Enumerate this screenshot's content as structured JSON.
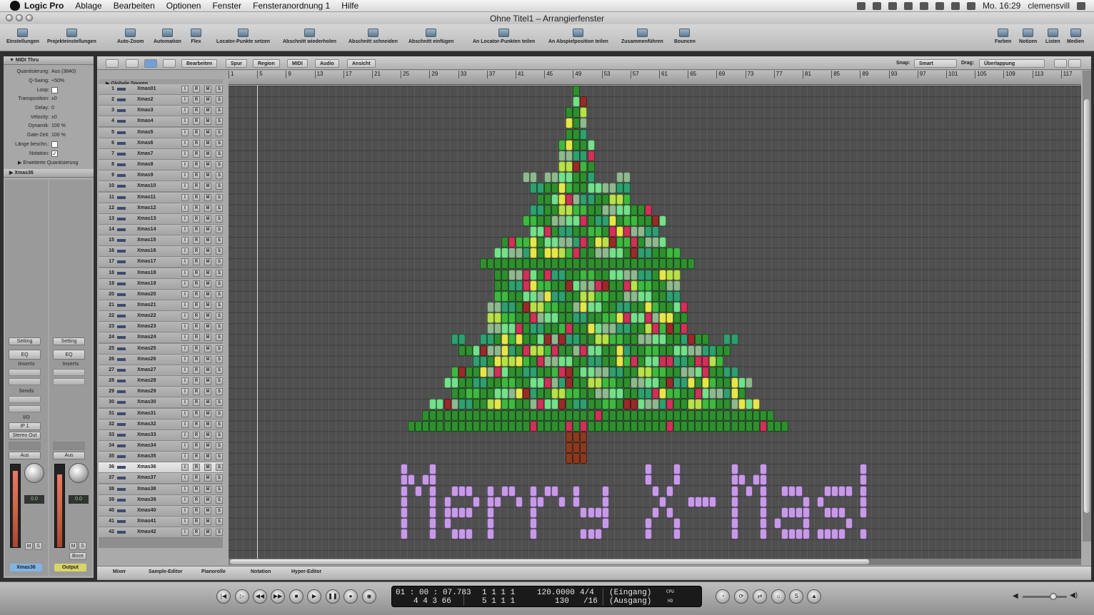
{
  "menubar": {
    "app": "Logic Pro",
    "items": [
      "Ablage",
      "Bearbeiten",
      "Optionen",
      "Fenster",
      "Fensteranordnung 1",
      "Hilfe"
    ],
    "clock": "Mo. 16:29",
    "user": "clemensvill"
  },
  "window": {
    "title": "Ohne Titel1 – Arrangierfenster"
  },
  "toolbar": {
    "items": [
      "Einstellungen",
      "Projekteinstellungen",
      "Auto-Zoom",
      "Automation",
      "Flex",
      "Locator-Punkte setzen",
      "Abschnitt wiederholen",
      "Abschnitt schneiden",
      "Abschnitt einfügen",
      "An Locator-Punkten teilen",
      "An Abspielposition teilen",
      "Zusammenführen",
      "Bouncen",
      "Farben",
      "Notizen",
      "Listen",
      "Medien"
    ]
  },
  "inspector": {
    "region_header": "MIDI Thru",
    "params": [
      {
        "label": "Quantisierung:",
        "value": "Aus (3840)"
      },
      {
        "label": "Q-Swing:",
        "value": "+50%"
      },
      {
        "label": "Loop:",
        "value": ""
      },
      {
        "label": "Transposition:",
        "value": "±0"
      },
      {
        "label": "Delay:",
        "value": "0"
      },
      {
        "label": "Velocity:",
        "value": "±0"
      },
      {
        "label": "Dynamik:",
        "value": "100 %"
      },
      {
        "label": "Gate-Zeit:",
        "value": "100 %"
      },
      {
        "label": "Länge beschn.:",
        "value": ""
      },
      {
        "label": "Notation:",
        "value": ""
      }
    ],
    "extended": "Erweiterte Quantisierung",
    "track_header": "Xmas36",
    "strip1": {
      "setting": "Setting",
      "eq": "EQ",
      "inserts": "Inserts",
      "sends": "Sends",
      "io": "I/O",
      "input": "IP 1",
      "output": "Stereo Out",
      "auto": "Aus",
      "pan": "0.0",
      "m": "M",
      "s": "S",
      "name": "Xmas36"
    },
    "strip2": {
      "setting": "Setting",
      "eq": "EQ",
      "inserts": "Inserts",
      "auto": "Aus",
      "pan": "0.0",
      "m": "M",
      "s": "S",
      "bnce": "Bnce",
      "name": "Output"
    }
  },
  "localmenu": {
    "menus": [
      "Bearbeiten",
      "Spur",
      "Region",
      "MIDI",
      "Audio",
      "Ansicht"
    ],
    "snap_label": "Snap:",
    "snap_value": "Smart",
    "drag_label": "Drag:",
    "drag_value": "Überlappung"
  },
  "global_tracks": "Globale Spuren",
  "ruler": {
    "marks": [
      "1",
      "5",
      "9",
      "13",
      "17",
      "21",
      "25",
      "29",
      "33",
      "37",
      "41",
      "45",
      "49",
      "53",
      "57",
      "61",
      "65",
      "69",
      "73",
      "77",
      "81",
      "85",
      "89",
      "93",
      "97",
      "101",
      "105",
      "109",
      "113",
      "117"
    ]
  },
  "tracks": [
    "Xmas01",
    "Xmas2",
    "Xmas3",
    "Xmas4",
    "Xmas5",
    "Xmas6",
    "Xmas7",
    "Xmas8",
    "Xmas9",
    "Xmas10",
    "Xmas11",
    "Xmas12",
    "Xmas13",
    "Xmas14",
    "Xmas15",
    "Xmas16",
    "Xmas17",
    "Xmas18",
    "Xmas19",
    "Xmas20",
    "Xmas21",
    "Xmas22",
    "Xmas23",
    "Xmas24",
    "Xmas25",
    "Xmas26",
    "Xmas27",
    "Xmas28",
    "Xmas29",
    "Xmas30",
    "Xmas31",
    "Xmas32",
    "Xmas33",
    "Xmas34",
    "Xmas35",
    "Xmas36",
    "Xmas37",
    "Xmas38",
    "Xmas39",
    "Xmas40",
    "Xmas41",
    "Xmas42"
  ],
  "track_buttons": [
    "I",
    "R",
    "M",
    "S"
  ],
  "selected_track": "Xmas36",
  "bottom_tabs": [
    "Mixer",
    "Sample-Editor",
    "Pianorolle",
    "Notation",
    "Hyper-Editor"
  ],
  "transport": {
    "smpte": "01 : 00 : 07.783",
    "smpte2": "4   4   3   66",
    "bars": "1   1   1     1",
    "bars2": "5   1   1     1",
    "tempo": "120.0000",
    "tempo2": "130",
    "sig": "4/4",
    "div": "/16",
    "in": "(Eingang)",
    "out": "(Ausgang)",
    "cpu": "CPU",
    "hd": "HD"
  },
  "colors": {
    "dark_green": "#2f8f2f",
    "green": "#3fb83f",
    "light_green": "#73e08a",
    "sage": "#8fb88f",
    "teal": "#2f9f6f",
    "lime": "#b8e04a",
    "yellow": "#e6e64a",
    "red": "#d0305a",
    "dark_red": "#9a2a2a",
    "trunk": "#8a3a1e",
    "lavender": "#c79ae8"
  },
  "chart_data": {
    "type": "table",
    "tree_rows": [
      {
        "track": 1,
        "runs": [
          [
            49,
            1
          ]
        ]
      },
      {
        "track": 2,
        "runs": [
          [
            49,
            2
          ]
        ]
      },
      {
        "track": 3,
        "runs": [
          [
            48,
            3
          ]
        ]
      },
      {
        "track": 4,
        "runs": [
          [
            48,
            3
          ]
        ]
      },
      {
        "track": 5,
        "runs": [
          [
            48,
            3
          ]
        ]
      },
      {
        "track": 6,
        "runs": [
          [
            47,
            5
          ]
        ]
      },
      {
        "track": 7,
        "runs": [
          [
            47,
            5
          ]
        ]
      },
      {
        "track": 8,
        "runs": [
          [
            47,
            5
          ]
        ]
      },
      {
        "track": 9,
        "runs": [
          [
            42,
            2
          ],
          [
            45,
            7
          ],
          [
            55,
            2
          ]
        ]
      },
      {
        "track": 10,
        "runs": [
          [
            43,
            14
          ]
        ]
      },
      {
        "track": 11,
        "runs": [
          [
            44,
            13
          ]
        ]
      },
      {
        "track": 12,
        "runs": [
          [
            43,
            17
          ]
        ]
      },
      {
        "track": 13,
        "runs": [
          [
            42,
            20
          ]
        ]
      },
      {
        "track": 14,
        "runs": [
          [
            43,
            18
          ]
        ]
      },
      {
        "track": 15,
        "runs": [
          [
            39,
            23
          ]
        ]
      },
      {
        "track": 16,
        "runs": [
          [
            38,
            26
          ]
        ]
      },
      {
        "track": 17,
        "runs": [
          [
            36,
            30
          ]
        ]
      },
      {
        "track": 18,
        "runs": [
          [
            38,
            26
          ]
        ]
      },
      {
        "track": 19,
        "runs": [
          [
            38,
            26
          ]
        ]
      },
      {
        "track": 20,
        "runs": [
          [
            38,
            26
          ]
        ]
      },
      {
        "track": 21,
        "runs": [
          [
            37,
            28
          ]
        ]
      },
      {
        "track": 22,
        "runs": [
          [
            37,
            28
          ]
        ]
      },
      {
        "track": 23,
        "runs": [
          [
            37,
            28
          ]
        ]
      },
      {
        "track": 24,
        "runs": [
          [
            32,
            2
          ],
          [
            36,
            32
          ],
          [
            70,
            2
          ]
        ]
      },
      {
        "track": 25,
        "runs": [
          [
            33,
            38
          ]
        ]
      },
      {
        "track": 26,
        "runs": [
          [
            35,
            35
          ]
        ]
      },
      {
        "track": 27,
        "runs": [
          [
            32,
            40
          ]
        ]
      },
      {
        "track": 28,
        "runs": [
          [
            31,
            43
          ]
        ]
      },
      {
        "track": 29,
        "runs": [
          [
            32,
            41
          ]
        ]
      },
      {
        "track": 30,
        "runs": [
          [
            29,
            46
          ]
        ]
      },
      {
        "track": 31,
        "runs": [
          [
            28,
            49
          ]
        ]
      },
      {
        "track": 32,
        "runs": [
          [
            26,
            53
          ]
        ]
      },
      {
        "track": 33,
        "runs": [
          [
            48,
            3
          ]
        ]
      },
      {
        "track": 34,
        "runs": [
          [
            48,
            3
          ]
        ]
      },
      {
        "track": 35,
        "runs": [
          [
            48,
            3
          ]
        ]
      }
    ],
    "text_art": "Merry X-Mas!"
  }
}
